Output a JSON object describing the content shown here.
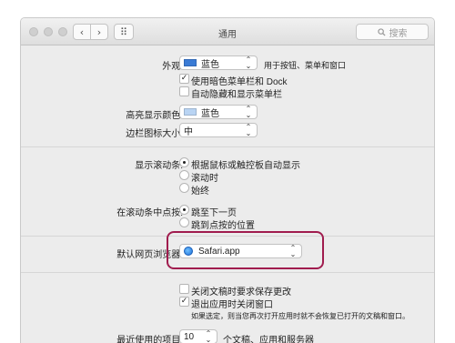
{
  "window": {
    "title": "通用"
  },
  "toolbar": {
    "back_glyph": "‹",
    "forward_glyph": "›",
    "grid_glyph": "⠿",
    "search_placeholder": "搜索"
  },
  "appearance": {
    "label": "外观:",
    "value": "蓝色",
    "swatch_color": "#3a7bd5",
    "after_text": "用于按钮、菜单和窗口",
    "dark_menu_label": "使用暗色菜单栏和 Dock",
    "dark_menu_checked": true,
    "autohide_label": "自动隐藏和显示菜单栏",
    "autohide_checked": false
  },
  "highlight_color": {
    "label": "高亮显示颜色:",
    "value": "蓝色",
    "swatch_color": "#b9d4f3"
  },
  "sidebar_icon_size": {
    "label": "边栏图标大小:",
    "value": "中"
  },
  "scrollbars": {
    "label": "显示滚动条:",
    "options": [
      "根据鼠标或触控板自动显示",
      "滚动时",
      "始终"
    ],
    "selected": 0
  },
  "scroll_click": {
    "label": "在滚动条中点按:",
    "options": [
      "跳至下一页",
      "跳到点按的位置"
    ],
    "selected": 0
  },
  "browser": {
    "label": "默认网页浏览器:",
    "value": "Safari.app"
  },
  "documents": {
    "ask_keep_label": "关闭文稿时要求保存更改",
    "ask_keep_checked": false,
    "close_windows_label": "退出应用时关闭窗口",
    "close_windows_checked": true,
    "close_windows_note": "如果选定，则当您再次打开应用时就不会恢复已打开的文稿和窗口。"
  },
  "recent_items": {
    "label": "最近使用的项目:",
    "value": "10",
    "after_text": "个文稿、应用和服务器"
  },
  "check_glyph": "✓",
  "chevron_glyph": "⌃⌄"
}
